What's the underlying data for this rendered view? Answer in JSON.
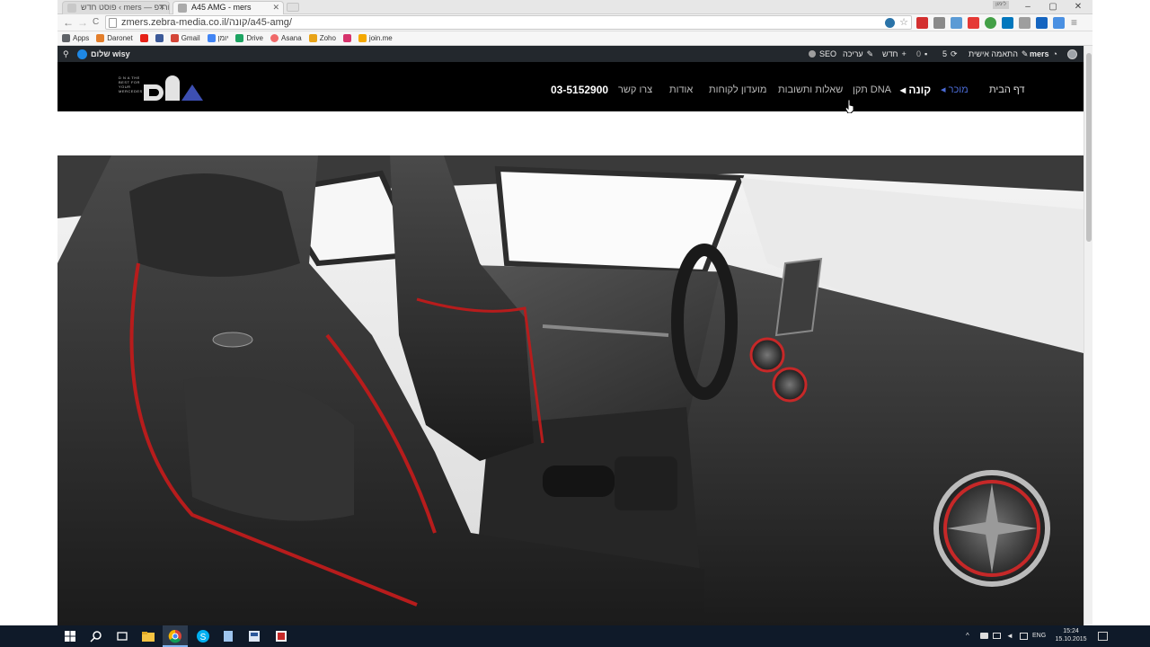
{
  "browser": {
    "tabs": [
      {
        "title": "פוסט חדש ‹ mers — וורדפ"
      },
      {
        "title": "A45 AMG - mers"
      }
    ],
    "window_controls": [
      "–",
      "▢",
      "✕"
    ],
    "user_chip": "לימון",
    "nav": {
      "back": "←",
      "forward": "→",
      "reload": "C"
    },
    "url": "zmers.zebra-media.co.il/קונה/a45-amg/",
    "star": "☆",
    "menu": "≡"
  },
  "bookmarks": [
    {
      "label": "Apps",
      "color": "#5f6368"
    },
    {
      "label": "Daronet",
      "color": "#e37e2b"
    },
    {
      "label": "",
      "color": "#e62117"
    },
    {
      "label": "",
      "color": "#3b5998"
    },
    {
      "label": "Gmail",
      "color": "#d44638"
    },
    {
      "label": "יומן",
      "color": "#4285f4"
    },
    {
      "label": "Drive",
      "color": "#1da462"
    },
    {
      "label": "Asana",
      "color": "#f06a6a"
    },
    {
      "label": "Zoho",
      "color": "#e8a317"
    },
    {
      "label": "",
      "color": "#d6336c"
    },
    {
      "label": "join.me",
      "color": "#f4a800"
    }
  ],
  "admin_bar": {
    "right_user": "mers",
    "personalize": "התאמה אישית",
    "updates": "5",
    "comments": "0",
    "new": "חדש",
    "edit": "עריכה",
    "seo": "SEO",
    "greeting": "שלום wisy"
  },
  "site": {
    "logo_tagline": "D N A THE BEST FOR YOUR MERCEDES",
    "nav": {
      "home": "דף הבית",
      "seller": "מוכר",
      "buyer": "קונה",
      "dna_kit": "תקן DNA",
      "faq": "שאלות ותשובות",
      "club": "מועדון לקוחות",
      "about": "אודות",
      "contact": "צרו קשר",
      "phone": "03-5152900"
    }
  },
  "colors": {
    "admin_bg": "#23282d",
    "site_header": "#000000",
    "accent_blue": "#3d4fb2",
    "taskbar": "#0f1a29"
  },
  "taskbar": {
    "lang": "ENG",
    "time": "15:24",
    "date": "15.10.2015"
  }
}
